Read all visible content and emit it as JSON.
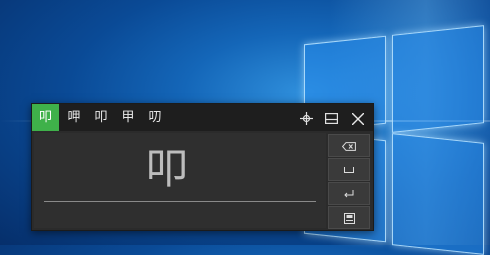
{
  "candidates": [
    "叩",
    "呷",
    "叩",
    "甲",
    "叨"
  ],
  "selected_index": 0,
  "toolbar": {
    "move_icon": "move-icon",
    "dock_icon": "dock-icon",
    "close_icon": "close-icon"
  },
  "writing_area": {
    "stroke_char": "叩"
  },
  "side_buttons": [
    "backspace-icon",
    "space-icon",
    "enter-icon",
    "clear-icon"
  ],
  "colors": {
    "accent": "#3fb14a",
    "panel": "#2b2b2b",
    "bar": "#1e1e1e"
  }
}
